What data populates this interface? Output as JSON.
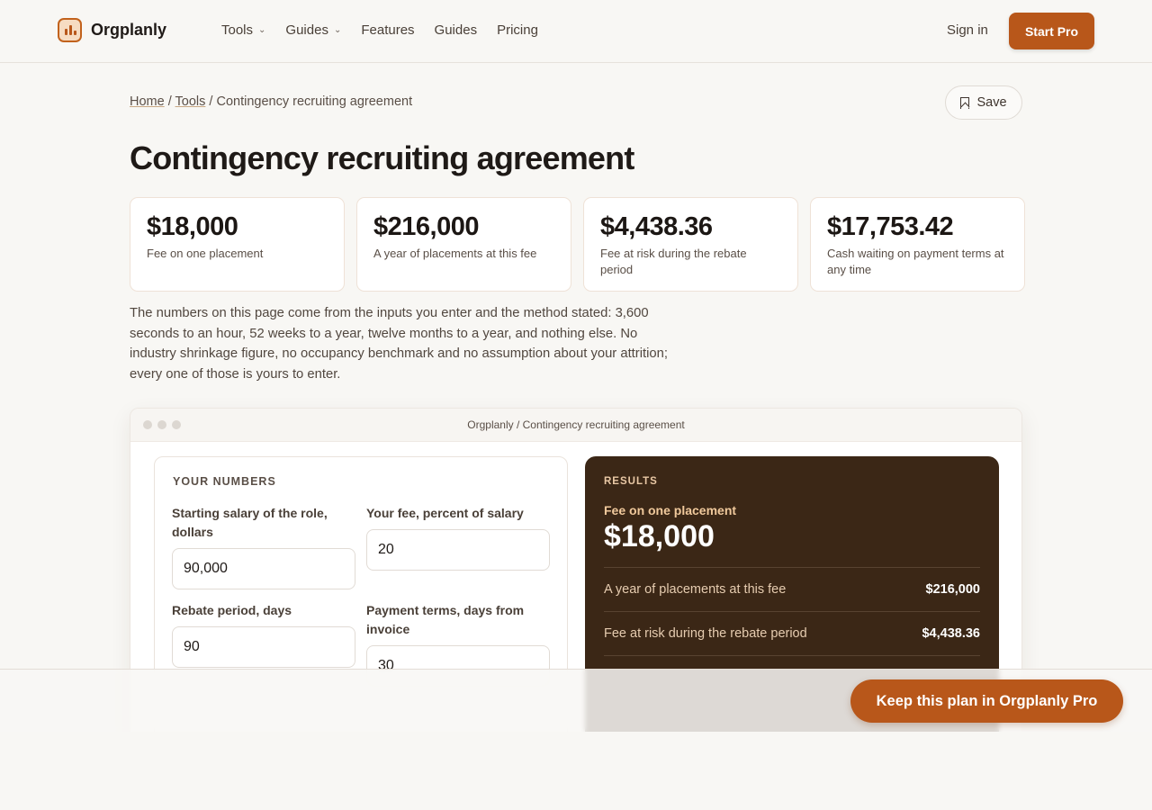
{
  "header": {
    "brand": "Orgplanly",
    "nav": [
      {
        "label": "Tools",
        "dropdown": true
      },
      {
        "label": "Guides",
        "dropdown": true
      },
      {
        "label": "Features",
        "dropdown": false
      },
      {
        "label": "Guides",
        "dropdown": false
      },
      {
        "label": "Pricing",
        "dropdown": false
      }
    ],
    "sign_in": "Sign in",
    "start_pro": "Start Pro"
  },
  "breadcrumb": {
    "home": "Home",
    "tools": "Tools",
    "current": "Contingency recruiting agreement",
    "separator": "/"
  },
  "save_label": "Save",
  "page_title": "Contingency recruiting agreement",
  "stats": [
    {
      "value": "$18,000",
      "label": "Fee on one placement"
    },
    {
      "value": "$216,000",
      "label": "A year of placements at this fee"
    },
    {
      "value": "$4,438.36",
      "label": "Fee at risk during the rebate period"
    },
    {
      "value": "$17,753.42",
      "label": "Cash waiting on payment terms at any time"
    }
  ],
  "intro": "The numbers on this page come from the inputs you enter and the method stated: 3,600 seconds to an hour, 52 weeks to a year, twelve months to a year, and nothing else. No industry shrinkage figure, no occupancy benchmark and no assumption about your attrition; every one of those is yours to enter.",
  "window": {
    "title": "Orgplanly / Contingency recruiting agreement"
  },
  "inputs": {
    "title": "YOUR NUMBERS",
    "salary": {
      "label": "Starting salary of the role, dollars",
      "value": "90,000"
    },
    "fee": {
      "label": "Your fee, percent of salary",
      "value": "20"
    },
    "rebate": {
      "label": "Rebate period, days",
      "value": "90"
    },
    "terms": {
      "label": "Payment terms, days from invoice",
      "value": "30"
    }
  },
  "results": {
    "title": "RESULTS",
    "headline_label": "Fee on one placement",
    "headline_value": "$18,000",
    "rows": [
      {
        "label": "A year of placements at this fee",
        "value": "$216,000"
      },
      {
        "label": "Fee at risk during the rebate period",
        "value": "$4,438.36"
      }
    ]
  },
  "sticky": {
    "cta": "Keep this plan in Orgplanly Pro"
  },
  "colors": {
    "accent": "#b8571a",
    "results_bg": "#3b2716",
    "page_bg": "#f8f7f4"
  }
}
